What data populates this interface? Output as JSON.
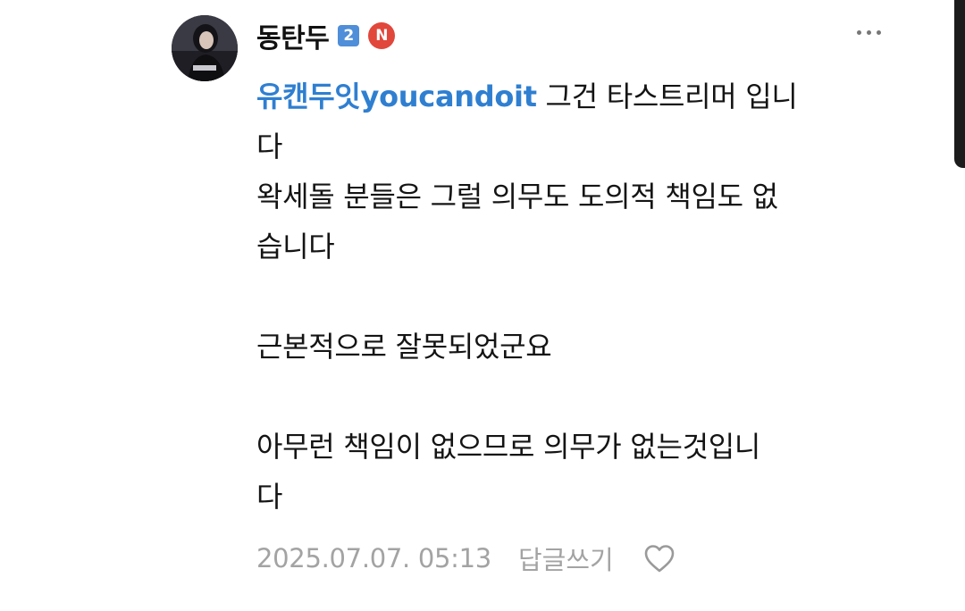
{
  "comment": {
    "author": {
      "nickname": "동탄두",
      "level_badge": "2",
      "n_badge": "N"
    },
    "body": {
      "mention": "유캔두잇youcandoit",
      "line1_rest": " 그건 타스트리머 입니",
      "line2": "다",
      "line3": "왁세돌 분들은 그럴 의무도 도의적 책임도 없",
      "line4": "습니다",
      "line5": "근본적으로 잘못되었군요",
      "line6": "아무런 책임이 없으므로 의무가 없는것입니",
      "line7": "다"
    },
    "timestamp": "2025.07.07. 05:13",
    "reply_label": "답글쓰기"
  },
  "icons": {
    "more": "more-dots-icon",
    "like": "heart-outline-icon",
    "avatar": "profile-avatar"
  },
  "colors": {
    "mention": "#2f7fd1",
    "level_badge": "#4f8ed8",
    "n_badge": "#e1473b",
    "meta_text": "#a3a3a3"
  }
}
